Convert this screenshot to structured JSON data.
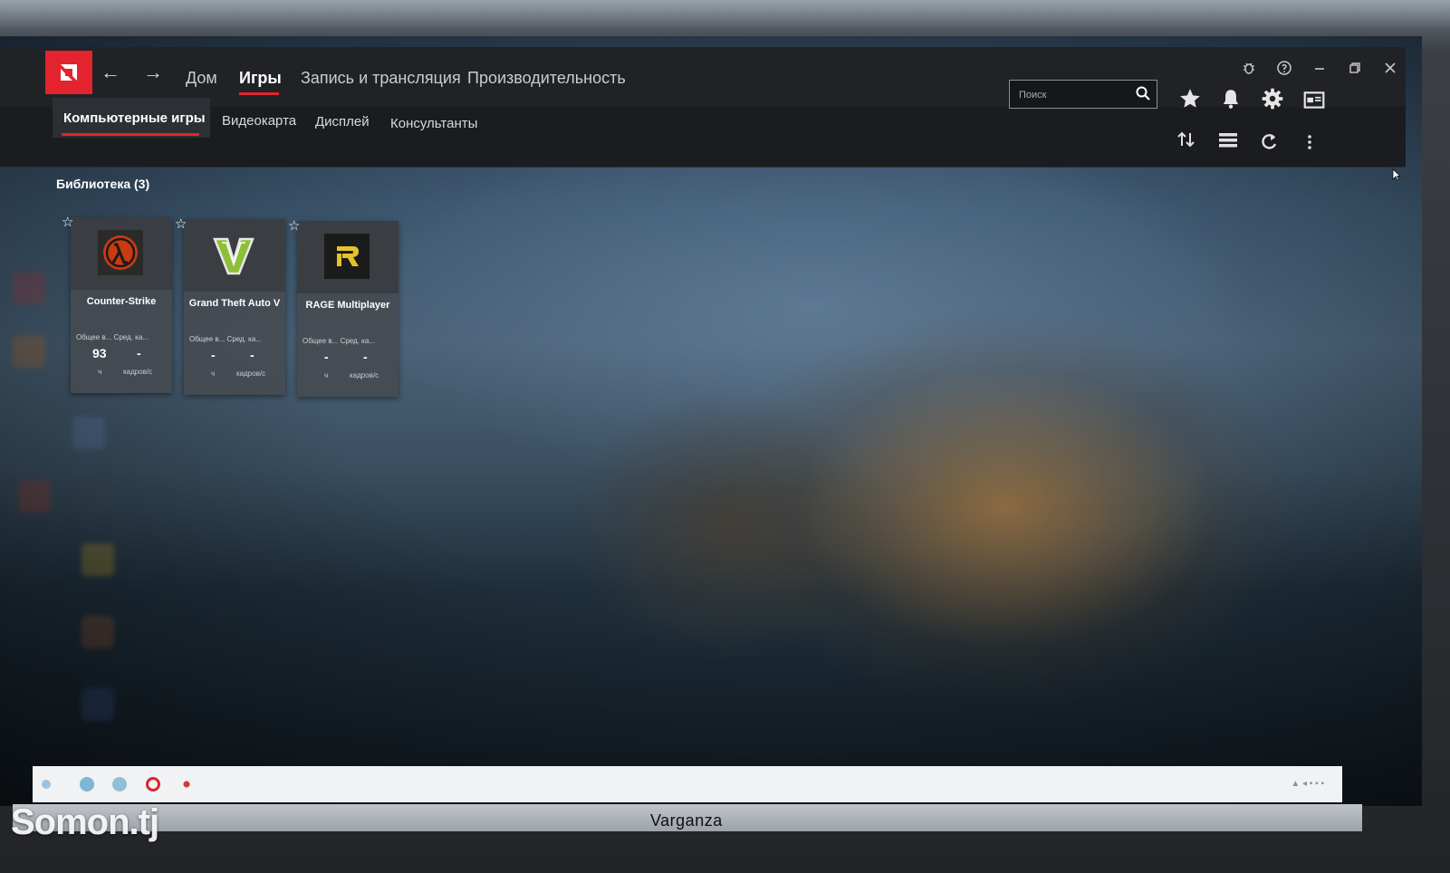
{
  "app": {
    "nav_back": "←",
    "nav_forward": "→",
    "top_nav": [
      "Дом",
      "Игры",
      "Запись и трансляция",
      "Производительность"
    ],
    "active_top_nav": "Игры",
    "window_controls": [
      "bug",
      "help",
      "minimize",
      "restore",
      "close"
    ],
    "search": {
      "placeholder": "Поиск",
      "value": ""
    },
    "toolbar_icons": [
      "star-icon",
      "bell-icon",
      "gear-icon",
      "monitor-icon"
    ],
    "sub_tabs": [
      "Компьютерные игры",
      "Видеокарта",
      "Дисплей",
      "Консультанты"
    ],
    "active_sub_tab": "Компьютерные игры",
    "sub_toolbar_icons": [
      "sort-icon",
      "list-view-icon",
      "refresh-icon",
      "more-icon"
    ],
    "accent": "#e3232e"
  },
  "library": {
    "title": "Библиотека (3)",
    "games": [
      {
        "name": "Counter-Strike",
        "stat_labels": "Общее в... Сред. ка...",
        "value_a": "93",
        "value_b": "-",
        "unit_a": "ч",
        "unit_b": "кадров/с",
        "icon": "half-life-lambda-icon"
      },
      {
        "name": "Grand Theft Auto V",
        "stat_labels": "Общее в... Сред. ка...",
        "value_a": "-",
        "value_b": "-",
        "unit_a": "ч",
        "unit_b": "кадров/с",
        "icon": "gta-v-icon"
      },
      {
        "name": "RAGE Multiplayer",
        "stat_labels": "Общее в... Сред. ка...",
        "value_a": "-",
        "value_b": "-",
        "unit_a": "ч",
        "unit_b": "кадров/с",
        "icon": "rage-r-icon"
      }
    ]
  },
  "monitor": {
    "brand": "Varganza"
  },
  "watermark": "Somon.tj"
}
